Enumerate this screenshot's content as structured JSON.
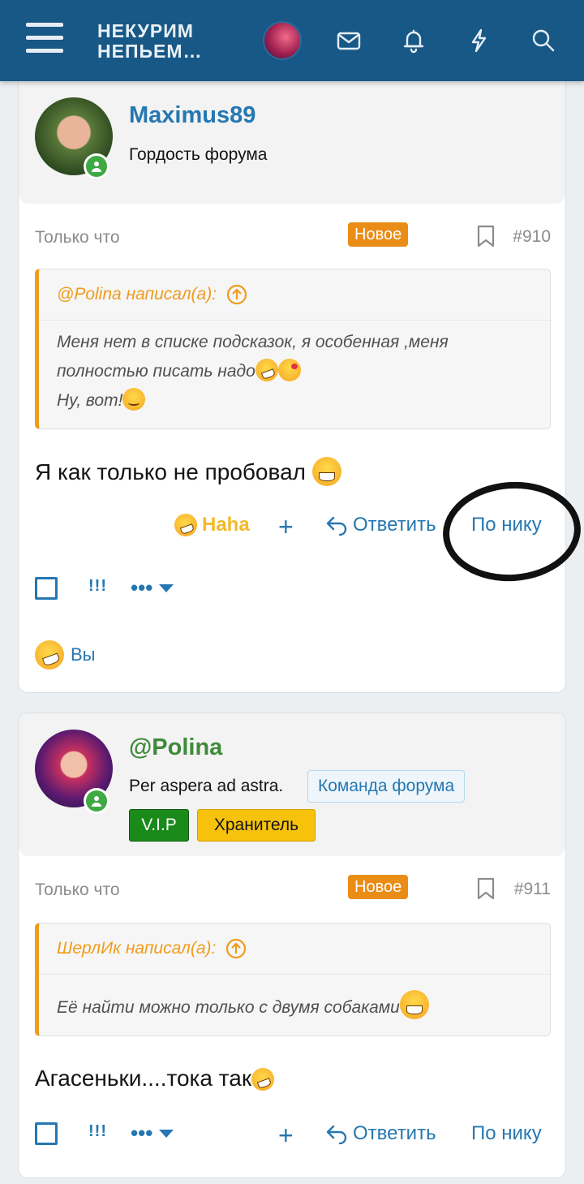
{
  "header": {
    "logo_line1": "НЕКУРИМ",
    "logo_line2": "НЕПЬЕМ…",
    "bg_color": "#185886",
    "icons": [
      "menu-icon",
      "avatar",
      "mail-icon",
      "bell-icon",
      "bolt-icon",
      "search-icon"
    ]
  },
  "posts": [
    {
      "username": "Maximus89",
      "user_title": "Гордость форума",
      "time": "Только что",
      "new_badge": "Новое",
      "post_number": "#910",
      "quote_author": "@Polina написал(а):",
      "quote_line1": "Меня нет в списке подсказок, я особенная ,меня",
      "quote_line2": "полностью писать надо",
      "quote_line3": "Ну, вот!",
      "text": "Я как только не пробовал",
      "reaction_label": "Haha",
      "plus_label": "+",
      "reply_label": "Ответить",
      "by_nick_label": "По нику",
      "excl_label": "!!!",
      "more_label": "•••",
      "reacted_by": "Вы"
    },
    {
      "username": "@Polina",
      "user_title": "Per aspera ad astra.",
      "team_badge": "Команда форума",
      "vip_badge": "V.I.P",
      "keeper_badge": "Хранитель",
      "time": "Только что",
      "new_badge": "Новое",
      "post_number": "#911",
      "quote_author": "ШерлИк написал(а):",
      "quote_line1": "Её найти можно только с двумя собаками",
      "text": "Агасеньки....тока так",
      "plus_label": "+",
      "reply_label": "Ответить",
      "by_nick_label": "По нику",
      "excl_label": "!!!",
      "more_label": "•••"
    }
  ],
  "colors": {
    "link": "#2577b1",
    "new_badge": "#ea8d17",
    "quote_accent": "#f09b1b",
    "online": "#3fa944",
    "vip": "#1a8a1a",
    "keeper": "#f6c20c"
  }
}
